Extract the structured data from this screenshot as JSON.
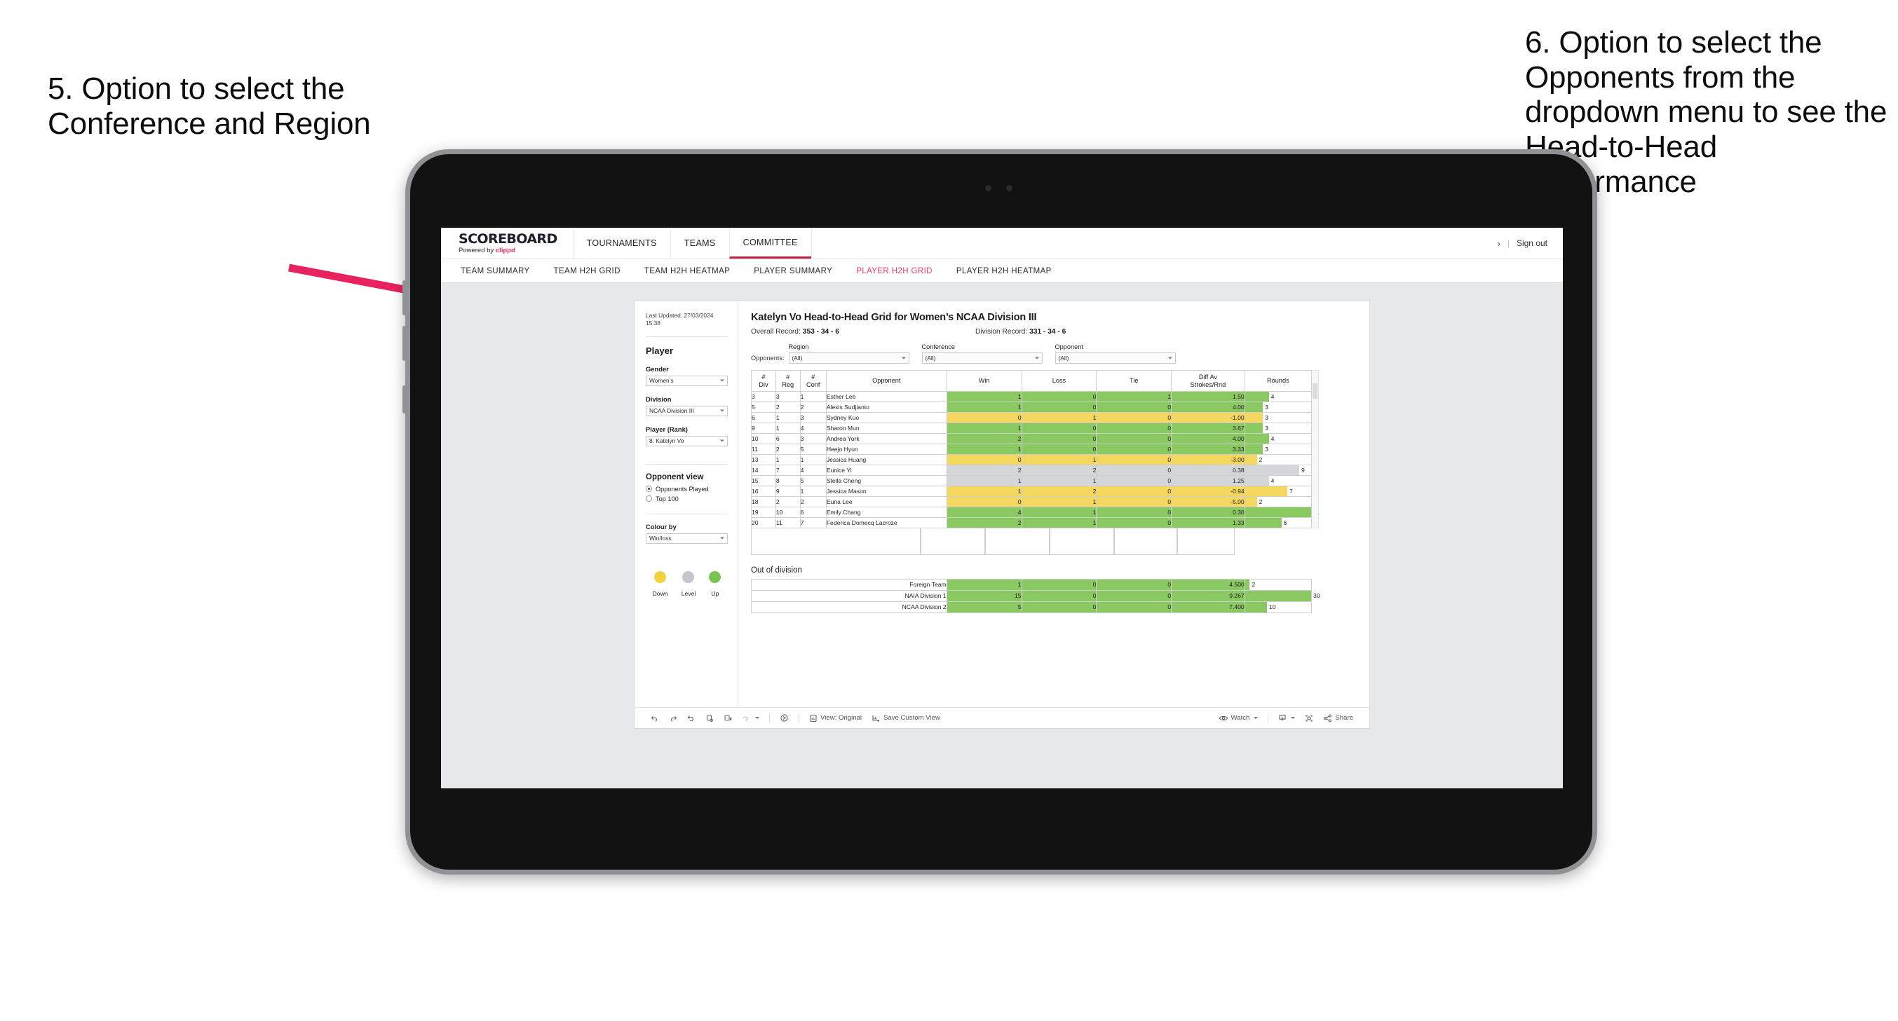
{
  "annotations": {
    "left": "5. Option to select the Conference and Region",
    "right": "6. Option to select the Opponents from the dropdown menu to see the Head-to-Head performance",
    "arrow_color": "#e8225f"
  },
  "topnav": {
    "brand_name": "SCOREBOARD",
    "brand_sub_prefix": "Powered by ",
    "brand_sub_brand": "clippd",
    "items": [
      {
        "label": "TOURNAMENTS",
        "active": false
      },
      {
        "label": "TEAMS",
        "active": false
      },
      {
        "label": "COMMITTEE",
        "active": true
      }
    ],
    "chevron": "›",
    "separator": "|",
    "signout": "Sign out"
  },
  "subnav": {
    "items": [
      {
        "label": "TEAM SUMMARY",
        "active": false
      },
      {
        "label": "TEAM H2H GRID",
        "active": false
      },
      {
        "label": "TEAM H2H HEATMAP",
        "active": false
      },
      {
        "label": "PLAYER SUMMARY",
        "active": false
      },
      {
        "label": "PLAYER H2H GRID",
        "active": true
      },
      {
        "label": "PLAYER H2H HEATMAP",
        "active": false
      }
    ],
    "active_color": "#ec3b63"
  },
  "sidebar": {
    "last_updated": "Last Updated: 27/03/2024 15:38",
    "title": "Player",
    "fields": [
      {
        "label": "Gender",
        "value": "Women’s"
      },
      {
        "label": "Division",
        "value": "NCAA Division III"
      },
      {
        "label": "Player (Rank)",
        "value": "8. Katelyn Vo"
      }
    ],
    "opponent_view": {
      "title": "Opponent view",
      "options": [
        {
          "label": "Opponents Played",
          "selected": true
        },
        {
          "label": "Top 100",
          "selected": false
        }
      ]
    },
    "colour_by": {
      "label": "Colour by",
      "value": "Win/loss"
    },
    "legend": [
      {
        "label": "Down",
        "color": "#f2d23e"
      },
      {
        "label": "Level",
        "color": "#c3c6cc"
      },
      {
        "label": "Up",
        "color": "#7ac552"
      }
    ]
  },
  "main": {
    "title": "Katelyn Vo Head-to-Head Grid for Women’s NCAA Division III",
    "overall_label": "Overall Record:",
    "overall_value": "353 - 34 - 6",
    "division_label": "Division Record:",
    "division_value": "331 -  34 - 6",
    "opponents_label": "Opponents:",
    "filters": [
      {
        "label": "Region",
        "value": "(All)"
      },
      {
        "label": "Conference",
        "value": "(All)"
      },
      {
        "label": "Opponent",
        "value": "(All)"
      }
    ]
  },
  "chart_data": {
    "type": "table",
    "title": "Katelyn Vo Head-to-Head Grid for Women’s NCAA Division III",
    "columns": [
      "# Div",
      "# Reg",
      "# Conf",
      "Opponent",
      "Win",
      "Loss",
      "Tie",
      "Diff Av Strokes/Rnd",
      "Rounds"
    ],
    "column_headers_multiline": [
      [
        "#",
        "Div"
      ],
      [
        "#",
        "Reg"
      ],
      [
        "#",
        "Conf"
      ],
      [
        "Opponent"
      ],
      [
        "Win"
      ],
      [
        "Loss"
      ],
      [
        "Tie"
      ],
      [
        "Diff Av",
        "Strokes/Rnd"
      ],
      [
        "Rounds"
      ]
    ],
    "rows": [
      {
        "div": "3",
        "reg": "3",
        "conf": "1",
        "opponent": "Esther Lee",
        "win": "1",
        "loss": "0",
        "tie": "1",
        "diff": "1.50",
        "rounds": "4",
        "status": "up",
        "rounds_pct": 36
      },
      {
        "div": "5",
        "reg": "2",
        "conf": "2",
        "opponent": "Alexis Sudjianto",
        "win": "1",
        "loss": "0",
        "tie": "0",
        "diff": "4.00",
        "rounds": "3",
        "status": "up",
        "rounds_pct": 27
      },
      {
        "div": "6",
        "reg": "1",
        "conf": "3",
        "opponent": "Sydney Kuo",
        "win": "0",
        "loss": "1",
        "tie": "0",
        "diff": "-1.00",
        "rounds": "3",
        "status": "down",
        "rounds_pct": 27
      },
      {
        "div": "9",
        "reg": "1",
        "conf": "4",
        "opponent": "Sharon Mun",
        "win": "1",
        "loss": "0",
        "tie": "0",
        "diff": "3.67",
        "rounds": "3",
        "status": "up",
        "rounds_pct": 27
      },
      {
        "div": "10",
        "reg": "6",
        "conf": "3",
        "opponent": "Andrea York",
        "win": "2",
        "loss": "0",
        "tie": "0",
        "diff": "4.00",
        "rounds": "4",
        "status": "up",
        "rounds_pct": 36
      },
      {
        "div": "11",
        "reg": "2",
        "conf": "5",
        "opponent": "Heejo Hyun",
        "win": "1",
        "loss": "0",
        "tie": "0",
        "diff": "3.33",
        "rounds": "3",
        "status": "up",
        "rounds_pct": 27
      },
      {
        "div": "13",
        "reg": "1",
        "conf": "1",
        "opponent": "Jessica Huang",
        "win": "0",
        "loss": "1",
        "tie": "0",
        "diff": "-3.00",
        "rounds": "2",
        "status": "down",
        "rounds_pct": 18
      },
      {
        "div": "14",
        "reg": "7",
        "conf": "4",
        "opponent": "Eunice Yi",
        "win": "2",
        "loss": "2",
        "tie": "0",
        "diff": "0.38",
        "rounds": "9",
        "status": "level",
        "rounds_pct": 82
      },
      {
        "div": "15",
        "reg": "8",
        "conf": "5",
        "opponent": "Stella Cheng",
        "win": "1",
        "loss": "1",
        "tie": "0",
        "diff": "1.25",
        "rounds": "4",
        "status": "level",
        "rounds_pct": 36
      },
      {
        "div": "16",
        "reg": "9",
        "conf": "1",
        "opponent": "Jessica Mason",
        "win": "1",
        "loss": "2",
        "tie": "0",
        "diff": "-0.94",
        "rounds": "7",
        "status": "down",
        "rounds_pct": 64
      },
      {
        "div": "18",
        "reg": "2",
        "conf": "2",
        "opponent": "Euna Lee",
        "win": "0",
        "loss": "1",
        "tie": "0",
        "diff": "-5.00",
        "rounds": "2",
        "status": "down",
        "rounds_pct": 18
      },
      {
        "div": "19",
        "reg": "10",
        "conf": "6",
        "opponent": "Emily Chang",
        "win": "4",
        "loss": "1",
        "tie": "0",
        "diff": "0.30",
        "rounds": "11",
        "status": "up",
        "rounds_pct": 100
      },
      {
        "div": "20",
        "reg": "11",
        "conf": "7",
        "opponent": "Federica Domecq Lacroze",
        "win": "2",
        "loss": "1",
        "tie": "0",
        "diff": "1.33",
        "rounds": "6",
        "status": "up",
        "rounds_pct": 55
      }
    ],
    "out_of_division": {
      "title": "Out of division",
      "rows": [
        {
          "name": "Foreign Team",
          "win": "1",
          "loss": "0",
          "tie": "0",
          "diff": "4.500",
          "rounds": "2",
          "status": "up",
          "rounds_pct": 7
        },
        {
          "name": "NAIA Division 1",
          "win": "15",
          "loss": "0",
          "tie": "0",
          "diff": "9.267",
          "rounds": "30",
          "status": "up",
          "rounds_pct": 100
        },
        {
          "name": "NCAA Division 2",
          "win": "5",
          "loss": "0",
          "tie": "0",
          "diff": "7.400",
          "rounds": "10",
          "status": "up",
          "rounds_pct": 33
        }
      ]
    },
    "colors": {
      "up": "#8ac861",
      "down": "#f4d75e",
      "level": "#d4d6d9"
    }
  },
  "bottombar": {
    "view_label": "View: Original",
    "save_label": "Save Custom View",
    "watch_label": "Watch",
    "share_label": "Share"
  }
}
